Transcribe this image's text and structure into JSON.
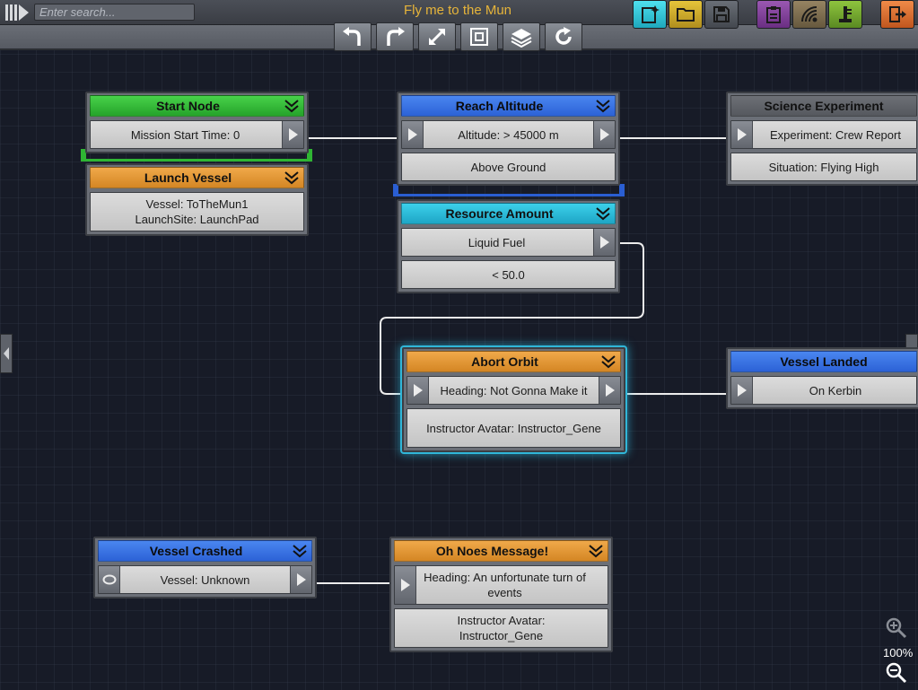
{
  "app": {
    "title": "Fly me to the Mun",
    "search_placeholder": "Enter search..."
  },
  "toolbar": {
    "buttons": [
      {
        "name": "undo-button",
        "icon": "undo-arrow-icon"
      },
      {
        "name": "redo-button",
        "icon": "redo-arrow-icon"
      },
      {
        "name": "expand-button",
        "icon": "expand-arrows-icon"
      },
      {
        "name": "fit-view-button",
        "icon": "fit-view-icon"
      },
      {
        "name": "layers-button",
        "icon": "layers-icon"
      },
      {
        "name": "refresh-button",
        "icon": "refresh-icon"
      }
    ]
  },
  "right_buttons": [
    {
      "name": "new-mission-button",
      "icon": "new-document-icon",
      "color": "#2fc6d6"
    },
    {
      "name": "open-mission-button",
      "icon": "folder-icon",
      "color": "#c9a628"
    },
    {
      "name": "save-mission-button",
      "icon": "floppy-disk-icon",
      "color": "#4d525a"
    },
    {
      "name": "briefing-button",
      "icon": "clipboard-icon",
      "color": "#7e3f94"
    },
    {
      "name": "ground-stations-button",
      "icon": "radar-dish-icon",
      "color": "#7a6a4e"
    },
    {
      "name": "launch-sites-button",
      "icon": "launch-tower-icon",
      "color": "#6f9a2e"
    },
    {
      "name": "exit-button",
      "icon": "exit-door-icon",
      "color": "#d9692d"
    }
  ],
  "nodes": {
    "start_node": {
      "title": "Start Node",
      "params": [
        "Mission Start Time: 0"
      ]
    },
    "launch_vessel": {
      "title": "Launch Vessel",
      "params": [
        "Vessel: ToTheMun1",
        "LaunchSite: LaunchPad"
      ]
    },
    "reach_altitude": {
      "title": "Reach Altitude",
      "params": [
        "Altitude: > 45000 m",
        "Above Ground"
      ]
    },
    "resource_amount": {
      "title": "Resource Amount",
      "params": [
        "Liquid Fuel",
        "< 50.0"
      ]
    },
    "science_experiment": {
      "title": "Science Experiment",
      "params": [
        "Experiment: Crew Report",
        "Situation: Flying High"
      ]
    },
    "abort_orbit": {
      "title": "Abort Orbit",
      "params": [
        "Heading: Not Gonna Make it",
        "Instructor Avatar: Instructor_Gene"
      ]
    },
    "vessel_landed": {
      "title": "Vessel Landed",
      "params": [
        "On Kerbin"
      ]
    },
    "vessel_crashed": {
      "title": "Vessel Crashed",
      "params": [
        "Vessel: Unknown"
      ]
    },
    "oh_noes": {
      "title": "Oh Noes Message!",
      "params": [
        "Heading: An unfortunate turn of events",
        "Instructor Avatar: Instructor_Gene"
      ]
    }
  },
  "colors": {
    "header_orange": "#e09a36",
    "header_blue": "#3a74e4",
    "header_green": "#36bd3a",
    "header_cyan": "#2ebcd8",
    "header_gray": "#616469",
    "selection_glow": "#30b6d8",
    "title_color": "#e6b43a"
  },
  "zoom": {
    "level": "100%"
  }
}
